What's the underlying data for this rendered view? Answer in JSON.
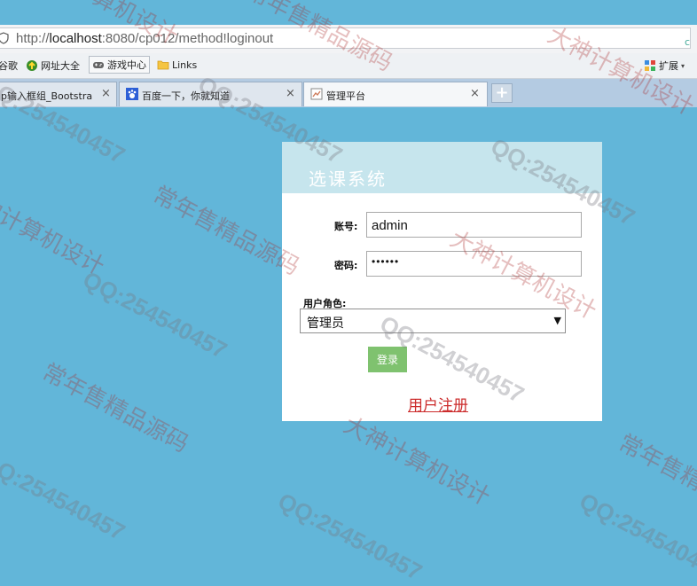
{
  "browser": {
    "address": {
      "scheme": "http://",
      "host": "localhost",
      "rest": ":8080/cp012/method!loginout"
    },
    "bookmarks": [
      {
        "label": "谷歌",
        "icon": "google-icon"
      },
      {
        "label": "网址大全",
        "icon": "site-directory-icon"
      },
      {
        "label": "游戏中心",
        "icon": "gamepad-icon"
      },
      {
        "label": "Links",
        "icon": "folder-icon"
      }
    ],
    "extensions_label": "扩展",
    "tabs": [
      {
        "title": "p输入框组_Bootstra",
        "active": false
      },
      {
        "title": "百度一下，你就知道",
        "active": false,
        "icon": "baidu-paw-icon"
      },
      {
        "title": "管理平台",
        "active": true,
        "icon": "page-icon"
      }
    ],
    "close_glyph": "×",
    "new_tab_glyph": "+"
  },
  "login": {
    "title": "选课系统",
    "username_label": "账号:",
    "username_value": "admin",
    "password_label": "密码:",
    "password_value": "••••••",
    "role_label": "用户角色:",
    "role_selected": "管理员",
    "login_button": "登录",
    "register_link": "用户注册"
  },
  "watermark": {
    "cn_shop": "常年售精品源码",
    "cn_god": "大神计算机设计",
    "qq": "QQ:254540457"
  },
  "colors": {
    "page_bg": "#62b6d9",
    "panel_header": "#c6e5ed",
    "login_button": "#7fc26f",
    "register_link": "#cc2c2c"
  }
}
